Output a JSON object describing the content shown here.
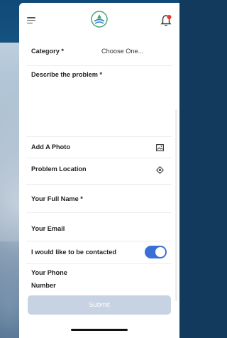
{
  "form": {
    "category_label": "Category *",
    "category_value": "Choose One...",
    "describe_label": "Describe the problem *",
    "photo_label": "Add A Photo",
    "location_label": "Problem Location",
    "name_label": "Your Full Name *",
    "email_label": "Your Email",
    "contact_label": "I would like to be contacted",
    "contact_enabled": true,
    "phone_label_line1": "Your Phone",
    "phone_label_line2": "Number",
    "submit_label": "Submit"
  },
  "colors": {
    "accent": "#3a6fd8",
    "submit_disabled": "#c7d2e2",
    "bell_badge": "#e53935"
  },
  "icons": {
    "menu": "hamburger-menu-icon",
    "logo": "app-logo",
    "bell": "notification-bell-icon",
    "photo": "image-icon",
    "location": "location-target-icon"
  }
}
